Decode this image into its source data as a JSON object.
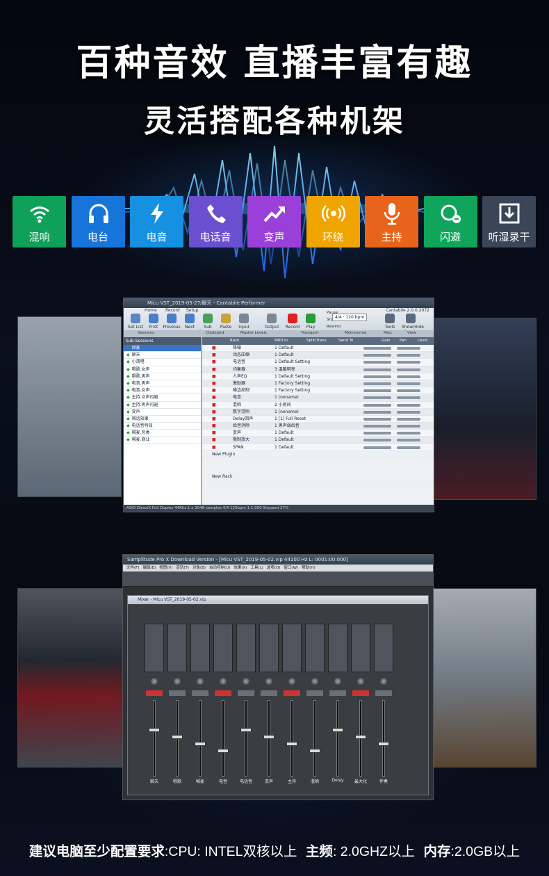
{
  "headline1": "百种音效  直播丰富有趣",
  "headline2": "灵活搭配各种机架",
  "effects": [
    {
      "label": "混响",
      "icon": "wifi-icon",
      "color": "#0fa05a"
    },
    {
      "label": "电台",
      "icon": "headphones-icon",
      "color": "#1775d9"
    },
    {
      "label": "电音",
      "icon": "lightning-icon",
      "color": "#1690e0"
    },
    {
      "label": "电话音",
      "icon": "phone-icon",
      "color": "#6a4fd0"
    },
    {
      "label": "变声",
      "icon": "trend-up-icon",
      "color": "#9a3fd8"
    },
    {
      "label": "环绕",
      "icon": "broadcast-icon",
      "color": "#f0a400"
    },
    {
      "label": "主持",
      "icon": "microphone-icon",
      "color": "#e8641a"
    },
    {
      "label": "闪避",
      "icon": "dodge-icon",
      "color": "#10a55a"
    },
    {
      "label": "听湿录干",
      "icon": "download-icon",
      "color": "#3a4658"
    }
  ],
  "cantabile": {
    "title": "Micu VST_2019-05-27/聊天 - Cantabile Performer",
    "version": "Cantabile 2.0.0.2072",
    "tabs": [
      "Home",
      "Record",
      "Setup"
    ],
    "ribbon": [
      "Set List",
      "First",
      "Previous",
      "Next",
      "Sub Sessions",
      "Paste",
      "Input",
      "Output",
      "Record",
      "Play",
      "Pause",
      "Stop",
      "Rewind",
      "Tools",
      "Show/Hide Panels"
    ],
    "groups": [
      "Sessions",
      "Clipboard",
      "Master Levels",
      "Transport",
      "Metronome",
      "Misc",
      "View"
    ],
    "tempo": "4/4 · 120 bpm",
    "subsessions_header": "Sub-Sessions",
    "subsessions": [
      "闭麦",
      "聊天",
      "小清唱",
      "唱歌.女声",
      "唱歌.男声",
      "电音.男声",
      "电音.女声",
      "主持.女声闪避",
      "主持.男声闪避",
      "变声",
      "喊话效果",
      "电话音特效",
      "喊麦.另类",
      "喊麦.商业"
    ],
    "columns": [
      "Rack",
      "MIDI In",
      "Split/Trans",
      "Send To",
      "Gain",
      "Pan",
      "Level"
    ],
    "plugins": [
      "降噪",
      "动态压缩",
      "电话音",
      "均衡器",
      "人声EQ",
      "激励器",
      "噪边抑制",
      "电音",
      "混响",
      "数字混响",
      "Delay回声",
      "齿音消除",
      "变声",
      "限制放大",
      "SPAN"
    ],
    "programs": [
      "1 Default",
      "1 Default",
      "1 Default Setting",
      "3 温暖明亮",
      "1 Default Setting",
      "1 Factory Setting",
      "1 Factory Setting",
      "1 (noname)",
      "2 小房间",
      "1 (noname)",
      "1 [1] Full Reset",
      "1 男声弱齿音",
      "1 Default",
      "1 Default",
      "1 Default"
    ],
    "new_plugin": "New Plugin",
    "new_rack": "New Rack",
    "status": "ASIO DirectX Full Duplex 44Khz 1 x 2048 samples    4/4    120bpm    1.1.000    Stopped    27%"
  },
  "samplitude": {
    "title": "Samplitude Pro X Download Version - [Micu VST_2019-05-02.vip    44100 Hz L: 0001:00:000]",
    "menu": [
      "文件(F)",
      "编辑(E)",
      "视图(V)",
      "音轨(T)",
      "对象(B)",
      "自动控制(U)",
      "效果(X)",
      "工具(L)",
      "选项(O)",
      "窗口(W)",
      "帮助(H)"
    ],
    "mixer_title": "Mixer - Micu VST_2019-05-02.vip",
    "channels": [
      "聊天",
      "唱歌",
      "喊麦",
      "电音",
      "电话音",
      "变声",
      "主持",
      "混响",
      "Delay",
      "最大化",
      "伴奏"
    ]
  },
  "requirements": {
    "label1": "建议电脑至少配置要求",
    "cpu": ":CPU: INTEL双核以上",
    "label2": "主频",
    "freq": ": 2.0GHZ以上",
    "label3": "内存",
    "mem": ":2.0GB以上"
  }
}
